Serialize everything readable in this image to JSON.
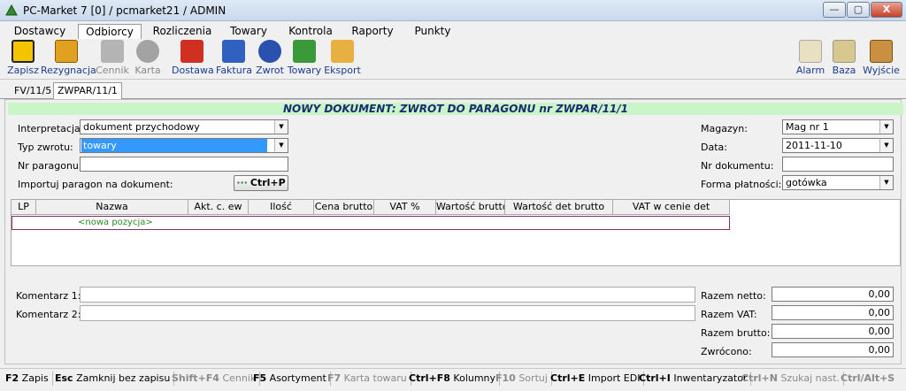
{
  "window": {
    "title": "PC-Market 7 [0] / pcmarket21 / ADMIN",
    "minimize": "—",
    "maximize": "▢",
    "close": "X"
  },
  "menu": [
    {
      "label": "Dostawcy"
    },
    {
      "label": "Odbiorcy"
    },
    {
      "label": "Rozliczenia"
    },
    {
      "label": "Towary"
    },
    {
      "label": "Kontrola"
    },
    {
      "label": "Raporty"
    },
    {
      "label": "Punkty"
    }
  ],
  "toolbar": {
    "left": [
      {
        "label": "Zapisz",
        "icon": "save-icon"
      },
      {
        "label": "Rezygnacja",
        "icon": "undo-icon"
      },
      {
        "label": "Cennik",
        "icon": "price-list-icon",
        "disabled": true
      },
      {
        "label": "Karta",
        "icon": "card-icon",
        "disabled": true
      },
      {
        "label": "Dostawa",
        "icon": "delivery-icon"
      },
      {
        "label": "Faktura",
        "icon": "invoice-icon"
      },
      {
        "label": "Zwrot",
        "icon": "return-icon"
      },
      {
        "label": "Towary",
        "icon": "goods-icon"
      },
      {
        "label": "Eksport",
        "icon": "export-icon"
      }
    ],
    "right": [
      {
        "label": "Alarm",
        "icon": "alarm-icon"
      },
      {
        "label": "Baza",
        "icon": "database-icon"
      },
      {
        "label": "Wyjście",
        "icon": "exit-door-icon"
      }
    ]
  },
  "doc_tabs": [
    "FV/11/5",
    "ZWPAR/11/1"
  ],
  "doc_header": "NOWY DOKUMENT: ZWROT DO PARAGONU nr ZWPAR/11/1",
  "form": {
    "interpretacja_label": "Interpretacja:",
    "interpretacja_value": "dokument przychodowy",
    "typ_zwrotu_label": "Typ zwrotu:",
    "typ_zwrotu_value": "towary",
    "nr_paragonu_label": "Nr paragonu:",
    "nr_paragonu_value": "",
    "importuj_label": "Importuj paragon na dokument:",
    "importuj_button": "Ctrl+P",
    "importuj_dots": "···",
    "magazyn_label": "Magazyn:",
    "magazyn_value": "Mag nr 1",
    "data_label": "Data:",
    "data_value": "2011-11-10",
    "nr_dokumentu_label": "Nr dokumentu:",
    "nr_dokumentu_value": "",
    "forma_platnosci_label": "Forma płatności:",
    "forma_platnosci_value": "gotówka"
  },
  "grid": {
    "columns": [
      "LP",
      "Nazwa",
      "Akt. c. ew",
      "Ilość",
      "Cena brutto",
      "VAT %",
      "Wartość brutto",
      "Wartość det brutto",
      "VAT w cenie det"
    ],
    "new_row_text": "<nowa pozycja>"
  },
  "footer": {
    "komentarz1_label": "Komentarz 1:",
    "komentarz2_label": "Komentarz 2:",
    "razem_netto_label": "Razem netto:",
    "razem_netto_value": "0,00",
    "razem_vat_label": "Razem VAT:",
    "razem_vat_value": "0,00",
    "razem_brutto_label": "Razem brutto:",
    "razem_brutto_value": "0,00",
    "zwrocono_label": "Zwrócono:",
    "zwrocono_value": "0,00"
  },
  "statusbar": [
    {
      "key": "F2",
      "label": "Zapis"
    },
    {
      "key": "Esc",
      "label": "Zamknij bez zapisu"
    },
    {
      "key": "Shift+F4",
      "label": "Cennik",
      "disabled": true
    },
    {
      "key": "F5",
      "label": "Asortyment"
    },
    {
      "key": "F7",
      "label": "Karta towaru",
      "disabled": true
    },
    {
      "key": "Ctrl+F8",
      "label": "Kolumny"
    },
    {
      "key": "F10",
      "label": "Sortuj",
      "disabled": true
    },
    {
      "key": "Ctrl+E",
      "label": "Import EDI"
    },
    {
      "key": "Ctrl+I",
      "label": "Inwentaryzator"
    },
    {
      "key": "Ctrl+N",
      "label": "Szukaj nast.",
      "disabled": true
    },
    {
      "key": "Ctrl/Alt+S",
      "label": "",
      "disabled": true
    }
  ],
  "colors": {
    "header_bg": "#c9f5c9",
    "header_text": "#1a2c6e",
    "selection": "#3399ff",
    "new_row_text": "#2a8a2a"
  }
}
